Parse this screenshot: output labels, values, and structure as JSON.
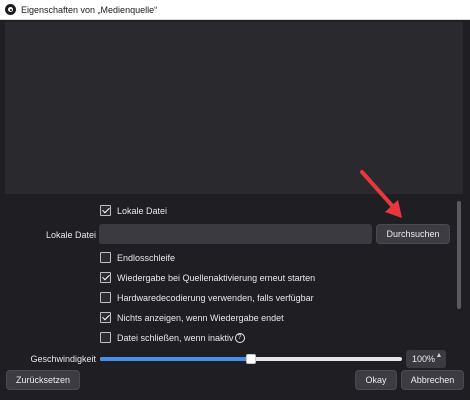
{
  "window": {
    "title": "Eigenschaften von „Medienquelle“"
  },
  "properties": {
    "local_file_checkbox": {
      "label": "Lokale Datei",
      "checked": true
    },
    "local_file_field": {
      "label": "Lokale Datei",
      "value": "",
      "browse_label": "Durchsuchen"
    },
    "options": [
      {
        "label": "Endlosschleife",
        "checked": false
      },
      {
        "label": "Wiedergabe bei Quellenaktivierung erneut starten",
        "checked": true
      },
      {
        "label": "Hardwaredecodierung verwenden, falls verfügbar",
        "checked": false
      },
      {
        "label": "Nichts anzeigen, wenn Wiedergabe endet",
        "checked": true
      },
      {
        "label": "Datei schließen, wenn inaktiv",
        "checked": false,
        "help_icon": "help-icon",
        "help_glyph": "?"
      }
    ],
    "speed": {
      "label": "Geschwindigkeit",
      "value_text": "100%",
      "fraction": 0.5
    }
  },
  "footer": {
    "reset_label": "Zurücksetzen",
    "ok_label": "Okay",
    "cancel_label": "Abbrechen"
  },
  "annotation": {
    "arrow_color": "#e8383d",
    "icon": "red-arrow-icon"
  }
}
